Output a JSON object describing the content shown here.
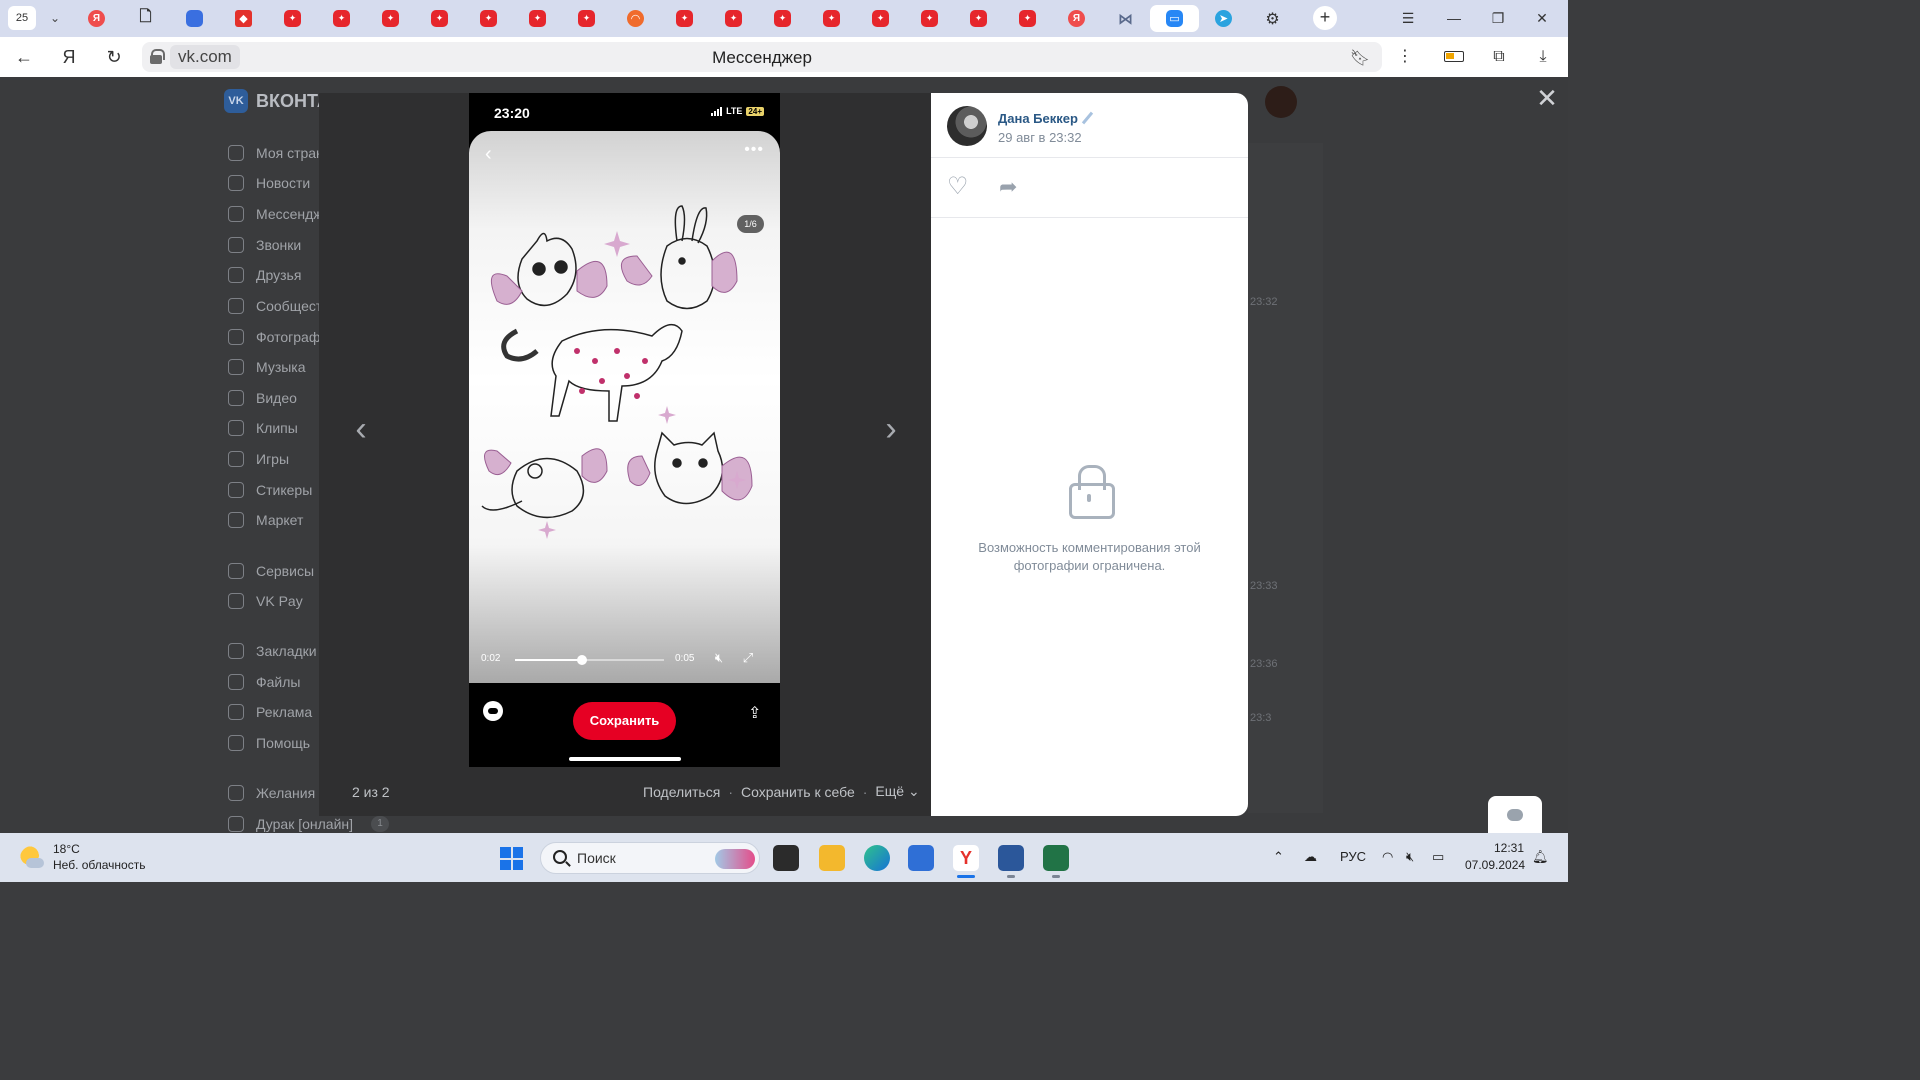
{
  "browser": {
    "tab_counter": "25",
    "tabs": [
      {
        "icon": "yandex-icon"
      },
      {
        "icon": "document-icon"
      },
      {
        "icon": "blue-app-icon"
      },
      {
        "icon": "brave-icon"
      },
      {
        "icon": "red-app-icon"
      },
      {
        "icon": "red-app-icon"
      },
      {
        "icon": "red-app-icon"
      },
      {
        "icon": "red-app-icon"
      },
      {
        "icon": "red-app-icon"
      },
      {
        "icon": "red-app-icon"
      },
      {
        "icon": "red-app-icon"
      },
      {
        "icon": "orange-app-icon"
      },
      {
        "icon": "red-app-icon"
      },
      {
        "icon": "red-app-icon"
      },
      {
        "icon": "red-app-icon"
      },
      {
        "icon": "red-app-icon"
      },
      {
        "icon": "red-app-icon"
      },
      {
        "icon": "red-app-icon"
      },
      {
        "icon": "red-app-icon"
      },
      {
        "icon": "red-app-icon"
      },
      {
        "icon": "yandex-icon"
      },
      {
        "icon": "network-icon"
      },
      {
        "icon": "vk-messenger-icon",
        "active": true
      },
      {
        "icon": "telegram-icon"
      },
      {
        "icon": "settings-gear-icon"
      }
    ],
    "url_host": "vk.com",
    "page_title": "Мессенджер"
  },
  "vk": {
    "logo_text": "ВКОНТА",
    "sidebar": [
      {
        "label": "Моя стран"
      },
      {
        "label": "Новости"
      },
      {
        "label": "Мессендж"
      },
      {
        "label": "Звонки"
      },
      {
        "label": "Друзья"
      },
      {
        "label": "Сообщест"
      },
      {
        "label": "Фотограф"
      },
      {
        "label": "Музыка"
      },
      {
        "label": "Видео"
      },
      {
        "label": "Клипы"
      },
      {
        "label": "Игры"
      },
      {
        "label": "Стикеры"
      },
      {
        "label": "Маркет"
      },
      {
        "label": "Сервисы"
      },
      {
        "label": "VK Pay"
      },
      {
        "label": "Закладки"
      },
      {
        "label": "Файлы"
      },
      {
        "label": "Реклама"
      },
      {
        "label": "Помощь"
      },
      {
        "label": "Желания"
      },
      {
        "label": "Дурак [онлайн]",
        "badge": "1"
      }
    ],
    "chat_times": [
      "23:32",
      "23:33",
      "23:36",
      "23:3"
    ]
  },
  "viewer": {
    "counter": "2 из 2",
    "actions": {
      "share": "Поделиться",
      "save": "Сохранить к себе",
      "more": "Ещё"
    },
    "phone": {
      "time": "23:20",
      "network": "LTE",
      "battery": "24+",
      "page_indicator": "1/6",
      "video_current": "0:02",
      "video_total": "0:05",
      "video_progress": 0.45,
      "save_button": "Сохранить"
    },
    "post": {
      "author": "Дана Беккер",
      "date": "29 авг в 23:32",
      "comments_restricted": "Возможность комментирования этой фотографии ограничена."
    }
  },
  "taskbar": {
    "weather_temp": "18°C",
    "weather_desc": "Неб. облачность",
    "search_placeholder": "Поиск",
    "lang": "РУС",
    "time": "12:31",
    "date": "07.09.2024"
  }
}
